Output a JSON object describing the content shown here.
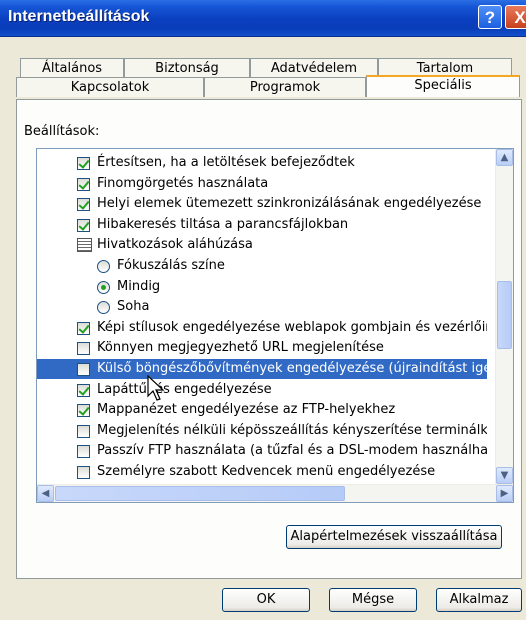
{
  "window": {
    "title": "Internetbeállítások"
  },
  "title_buttons": {
    "help": "?",
    "close": "X"
  },
  "tabs": {
    "row1": [
      "Általános",
      "Biztonság",
      "Adatvédelem",
      "Tartalom"
    ],
    "row2": [
      "Kapcsolatok",
      "Programok",
      "Speciális"
    ],
    "active": "Speciális"
  },
  "settings_label": "Beállítások:",
  "items": [
    {
      "type": "checkbox",
      "checked": true,
      "label": "Értesítsen, ha a letöltések befejeződtek"
    },
    {
      "type": "checkbox",
      "checked": true,
      "label": "Finomgörgetés használata"
    },
    {
      "type": "checkbox",
      "checked": true,
      "label": "Helyi elemek ütemezett szinkronizálásának engedélyezése"
    },
    {
      "type": "checkbox",
      "checked": true,
      "label": "Hibakeresés tiltása a parancsfájlokban"
    },
    {
      "type": "group",
      "label": "Hivatkozások aláhúzása"
    },
    {
      "type": "radio",
      "checked": false,
      "label": "Fókuszálás színe"
    },
    {
      "type": "radio",
      "checked": true,
      "label": "Mindig"
    },
    {
      "type": "radio",
      "checked": false,
      "label": "Soha"
    },
    {
      "type": "checkbox",
      "checked": true,
      "label": "Képi stílusok engedélyezése weblapok gombjain és vezérlőin"
    },
    {
      "type": "checkbox",
      "checked": false,
      "label": "Könnyen megjegyezhető URL megjelenítése"
    },
    {
      "type": "checkbox",
      "checked": false,
      "selected": true,
      "label": "Külső böngészőbővítmények engedélyezése (újraindítást igén"
    },
    {
      "type": "checkbox",
      "checked": true,
      "label": "Lapáttűnés engedélyezése"
    },
    {
      "type": "checkbox",
      "checked": true,
      "label": "Mappanézet engedélyezése az FTP-helyekhez"
    },
    {
      "type": "checkbox",
      "checked": false,
      "label": "Megjelenítés nélküli képösszeállítás kényszerítése terminálkis:"
    },
    {
      "type": "checkbox",
      "checked": false,
      "label": "Passzív FTP használata (a tűzfal és a DSL-modem használhat"
    },
    {
      "type": "checkbox",
      "checked": false,
      "label": "Személyre szabott Kedvencek menü engedélyezése"
    }
  ],
  "restore_button": "Alapértelmezések visszaállítása",
  "buttons": {
    "ok": "OK",
    "cancel": "Mégse",
    "apply": "Alkalmaz"
  },
  "colors": {
    "title_bar": "#0a3fbf",
    "selection": "#316ac5",
    "check": "#21a121",
    "active_tab_accent": "#f5a623"
  }
}
